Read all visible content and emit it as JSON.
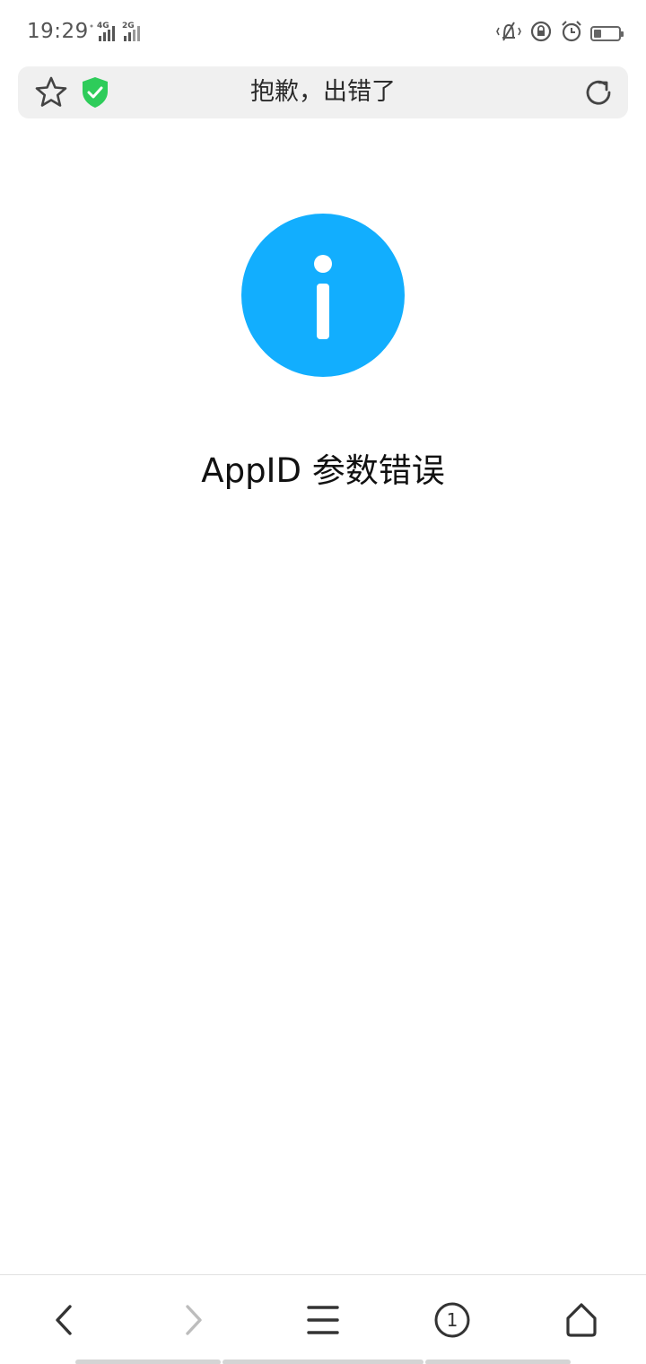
{
  "status_bar": {
    "time": "19:29",
    "signal_1_label": "4G",
    "signal_2_label": "2G",
    "battery_level": 0.3,
    "icons": [
      "vibrate-mute-icon",
      "rotation-lock-icon",
      "alarm-icon",
      "battery-icon"
    ]
  },
  "address_bar": {
    "title": "抱歉，出错了",
    "icons": [
      "star-icon",
      "shield-check-icon",
      "refresh-icon"
    ],
    "shield_color": "#2ecc5a"
  },
  "content": {
    "icon": "info-icon",
    "icon_color": "#12aefe",
    "message": "AppID 参数错误"
  },
  "bottom_nav": {
    "tab_count": "1",
    "items": [
      "back-icon",
      "forward-icon",
      "menu-icon",
      "tabs-icon",
      "home-icon"
    ]
  }
}
